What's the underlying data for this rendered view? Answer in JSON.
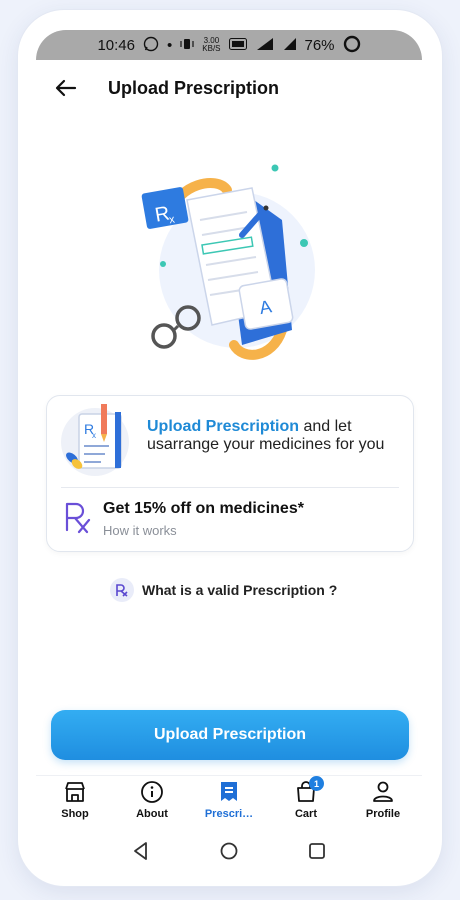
{
  "status_bar": {
    "time": "10:46",
    "whatsapp_icon": "whatsapp-icon",
    "dot": "•",
    "net_speed": "3.00",
    "net_unit": "KB/S",
    "battery": "76%"
  },
  "header": {
    "back_icon": "arrow-left-icon",
    "title": "Upload Prescription"
  },
  "card": {
    "headline_highlight": "Upload Prescription",
    "headline_rest": " and let usarrange your medicines for you",
    "offer_title": "Get 15% off on medicines*",
    "offer_link": "How it works"
  },
  "valid_link": "What is a valid Prescription ?",
  "primary_button": "Upload Prescription",
  "bottom_nav": {
    "items": [
      {
        "label": "Shop",
        "icon": "store-icon"
      },
      {
        "label": "About",
        "icon": "info-icon"
      },
      {
        "label": "Prescri…",
        "icon": "prescription-icon",
        "active": true
      },
      {
        "label": "Cart",
        "icon": "cart-icon",
        "badge": "1"
      },
      {
        "label": "Profile",
        "icon": "profile-icon"
      }
    ]
  },
  "colors": {
    "accent": "#1f8ee0",
    "active_nav": "#1f6fd6",
    "status_bar": "#a9a9a9"
  }
}
